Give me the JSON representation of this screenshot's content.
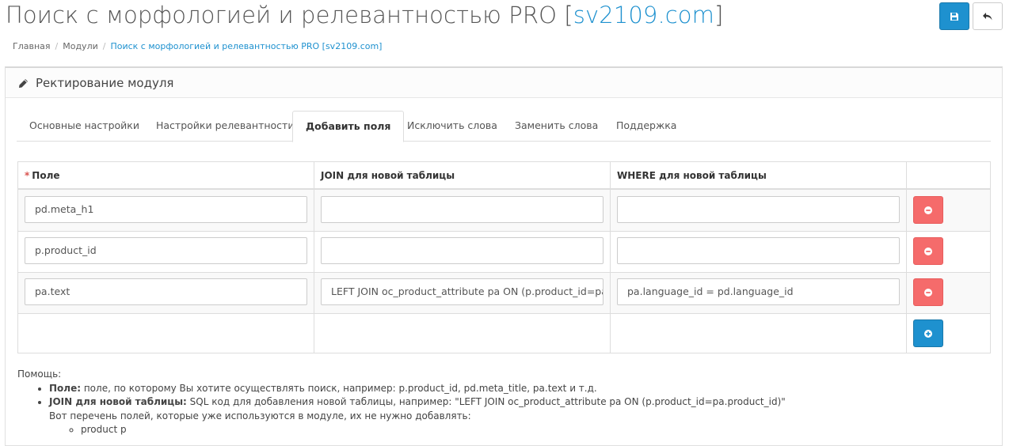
{
  "header": {
    "title_main": "Поиск с морфологией и релевантностью PRO [",
    "title_domain": "sv2109.com",
    "title_end": "]",
    "save_icon": "save-icon",
    "back_icon": "reply-icon",
    "accent": "#1e91cf"
  },
  "breadcrumb": {
    "items": [
      "Главная",
      "Модули",
      "Поиск с морфологией и релевантностью PRO [sv2109.com]"
    ]
  },
  "panel": {
    "title": "Ректирование модуля",
    "icon": "pencil-icon"
  },
  "tabs": [
    {
      "label": "Основные настройки",
      "active": false
    },
    {
      "label": "Настройки релевантности",
      "active": false
    },
    {
      "label": "Добавить поля",
      "active": true
    },
    {
      "label": "Исключить слова",
      "active": false
    },
    {
      "label": "Заменить слова",
      "active": false
    },
    {
      "label": "Поддержка",
      "active": false
    }
  ],
  "table": {
    "required_mark": "*",
    "headers": [
      "Поле",
      "JOIN для новой таблицы",
      "WHERE для новой таблицы"
    ],
    "rows": [
      {
        "field": "pd.meta_h1",
        "join": "",
        "where": ""
      },
      {
        "field": "p.product_id",
        "join": "",
        "where": ""
      },
      {
        "field": "pa.text",
        "join": "LEFT JOIN oc_product_attribute pa ON (p.product_id=pa.product_id)",
        "where": "pa.language_id = pd.language_id"
      }
    ],
    "remove_icon": "minus-circle-icon",
    "add_icon": "plus-circle-icon",
    "danger_color": "#f56b6b"
  },
  "help": {
    "title": "Помощь:",
    "item1_label": "Поле:",
    "item1_text": " поле, по которому Вы хотите осуществлять поиск, например: p.product_id, pd.meta_title, pa.text и т.д.",
    "item2_label": "JOIN для новой таблицы:",
    "item2_text": " SQL код для добавления новой таблицы, например: \"LEFT JOIN oc_product_attribute pa ON (p.product_id=pa.product_id)\"",
    "item2_sub": "Вот перечень полей, которые уже используются в модуле, их не нужно добавлять:",
    "sub_items": [
      "product p"
    ]
  }
}
